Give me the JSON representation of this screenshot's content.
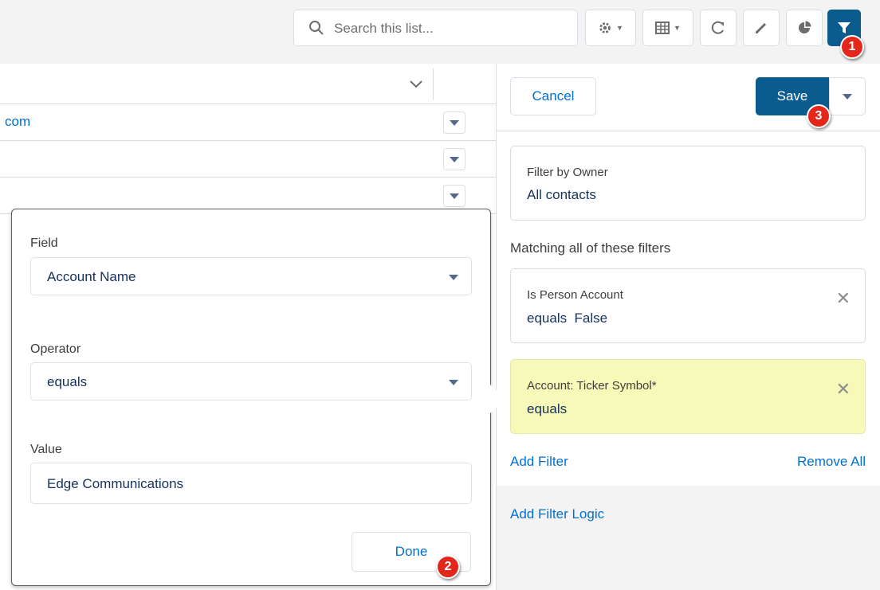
{
  "toolbar": {
    "search_placeholder": "Search this list...",
    "buttons": [
      "settings-icon",
      "table-view-icon",
      "refresh-icon",
      "edit-icon",
      "chart-icon",
      "filter-icon"
    ]
  },
  "table": {
    "rows": [
      {
        "text": "com"
      },
      {
        "text": ""
      },
      {
        "text": ""
      }
    ]
  },
  "filter_panel": {
    "cancel_label": "Cancel",
    "save_label": "Save",
    "owner": {
      "label": "Filter by Owner",
      "value": "All contacts"
    },
    "matching_label": "Matching all of these filters",
    "filters": [
      {
        "label": "Is Person Account",
        "value": "equals  False",
        "highlighted": false
      },
      {
        "label": "Account: Ticker Symbol*",
        "value": "equals",
        "highlighted": true
      }
    ],
    "add_filter_label": "Add Filter",
    "remove_all_label": "Remove All",
    "add_filter_logic_label": "Add Filter Logic"
  },
  "filter_editor": {
    "field_label": "Field",
    "field_value": "Account Name",
    "operator_label": "Operator",
    "operator_value": "equals",
    "value_label": "Value",
    "value_value": "Edge Communications",
    "done_label": "Done"
  },
  "steps": {
    "one": "1",
    "two": "2",
    "three": "3"
  },
  "colors": {
    "brand": "#0b5c8e",
    "link": "#0070d2",
    "highlight": "#f6f9b8",
    "badge": "#e3281b"
  }
}
